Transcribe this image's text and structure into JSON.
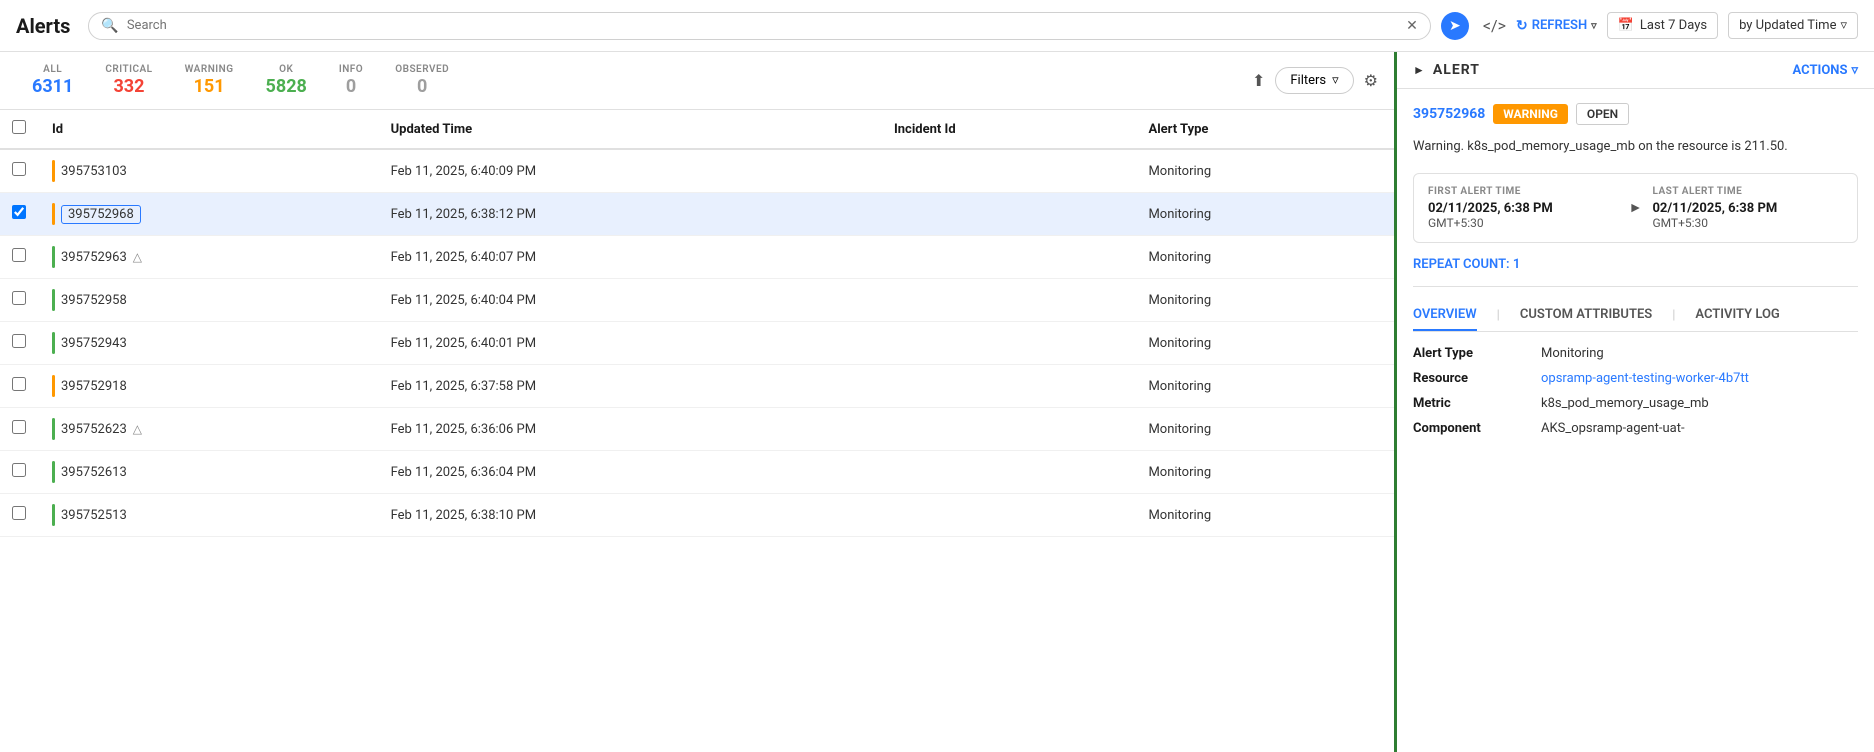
{
  "header": {
    "title": "Alerts",
    "search_placeholder": "Search",
    "refresh_label": "REFRESH",
    "time_range": "Last 7 Days",
    "sort_label": "by Updated Time",
    "calendar_icon": "📅",
    "caret": "▾"
  },
  "stats": {
    "all_label": "ALL",
    "all_value": "6311",
    "critical_label": "CRITICAL",
    "critical_value": "332",
    "warning_label": "WARNING",
    "warning_value": "151",
    "ok_label": "OK",
    "ok_value": "5828",
    "info_label": "INFO",
    "info_value": "0",
    "observed_label": "OBSERVED",
    "observed_value": "0",
    "filters_label": "Filters"
  },
  "table": {
    "col_id": "Id",
    "col_updated": "Updated Time",
    "col_incident": "Incident Id",
    "col_alert_type": "Alert Type",
    "rows": [
      {
        "id": "395753103",
        "severity": "warning",
        "updated": "Feb 11, 2025, 6:40:09 PM",
        "incident": "",
        "alert_type": "Monitoring",
        "has_icon": false,
        "selected": false
      },
      {
        "id": "395752968",
        "severity": "warning",
        "updated": "Feb 11, 2025, 6:38:12 PM",
        "incident": "",
        "alert_type": "Monitoring",
        "has_icon": false,
        "selected": true
      },
      {
        "id": "395752963",
        "severity": "ok",
        "updated": "Feb 11, 2025, 6:40:07 PM",
        "incident": "",
        "alert_type": "Monitoring",
        "has_icon": true,
        "selected": false
      },
      {
        "id": "395752958",
        "severity": "ok",
        "updated": "Feb 11, 2025, 6:40:04 PM",
        "incident": "",
        "alert_type": "Monitoring",
        "has_icon": false,
        "selected": false
      },
      {
        "id": "395752943",
        "severity": "ok",
        "updated": "Feb 11, 2025, 6:40:01 PM",
        "incident": "",
        "alert_type": "Monitoring",
        "has_icon": false,
        "selected": false
      },
      {
        "id": "395752918",
        "severity": "warning",
        "updated": "Feb 11, 2025, 6:37:58 PM",
        "incident": "",
        "alert_type": "Monitoring",
        "has_icon": false,
        "selected": false
      },
      {
        "id": "395752623",
        "severity": "ok",
        "updated": "Feb 11, 2025, 6:36:06 PM",
        "incident": "",
        "alert_type": "Monitoring",
        "has_icon": true,
        "selected": false
      },
      {
        "id": "395752613",
        "severity": "ok",
        "updated": "Feb 11, 2025, 6:36:04 PM",
        "incident": "",
        "alert_type": "Monitoring",
        "has_icon": false,
        "selected": false
      },
      {
        "id": "395752513",
        "severity": "ok",
        "updated": "Feb 11, 2025, 6:38:10 PM",
        "incident": "",
        "alert_type": "Monitoring",
        "has_icon": false,
        "selected": false
      }
    ]
  },
  "detail_panel": {
    "title": "ALERT",
    "actions_label": "ACTIONS",
    "alert_id": "395752968",
    "badge_warning": "WARNING",
    "badge_open": "OPEN",
    "message": "Warning. k8s_pod_memory_usage_mb on the resource is 211.50.",
    "first_alert_label": "FIRST ALERT TIME",
    "first_alert_date": "02/11/2025, 6:38 PM",
    "first_alert_tz": "GMT+5:30",
    "last_alert_label": "LAST ALERT TIME",
    "last_alert_date": "02/11/2025, 6:38 PM",
    "last_alert_tz": "GMT+5:30",
    "repeat_label": "REPEAT COUNT:",
    "repeat_value": "1",
    "tab_overview": "OVERVIEW",
    "tab_custom": "CUSTOM ATTRIBUTES",
    "tab_activity": "ACTIVITY LOG",
    "fields": [
      {
        "key": "Alert Type",
        "value": "Monitoring",
        "is_link": false
      },
      {
        "key": "Resource",
        "value": "opsramp-agent-testing-worker-4b7tt",
        "is_link": true
      },
      {
        "key": "Metric",
        "value": "k8s_pod_memory_usage_mb",
        "is_link": false
      },
      {
        "key": "Component",
        "value": "AKS_opsramp-agent-uat-",
        "is_link": false
      }
    ]
  }
}
